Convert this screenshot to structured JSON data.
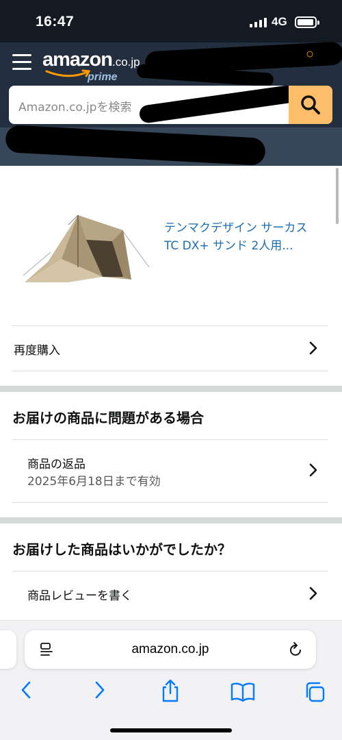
{
  "status_bar": {
    "time": "16:47",
    "network": "4G"
  },
  "header": {
    "logo_text": "amazon",
    "logo_tld": ".co.jp",
    "logo_prime": "prime",
    "search_placeholder": "Amazon.co.jpを検索"
  },
  "product": {
    "title": "テンマクデザイン サーカス TC DX+ サンド 2人用..."
  },
  "actions": {
    "buy_again": "再度購入"
  },
  "problem_section": {
    "title": "お届けの商品に問題がある場合",
    "return_label": "商品の返品",
    "return_deadline": "2025年6月18日まで有効"
  },
  "review_section": {
    "title": "お届けした商品はいかがでしたか？",
    "write_review": "商品レビューを書く"
  },
  "browser": {
    "url": "amazon.co.jp"
  },
  "colors": {
    "header_bg": "#232f3e",
    "search_button": "#febd69",
    "link": "#1a6db3",
    "ios_blue": "#007aff"
  }
}
